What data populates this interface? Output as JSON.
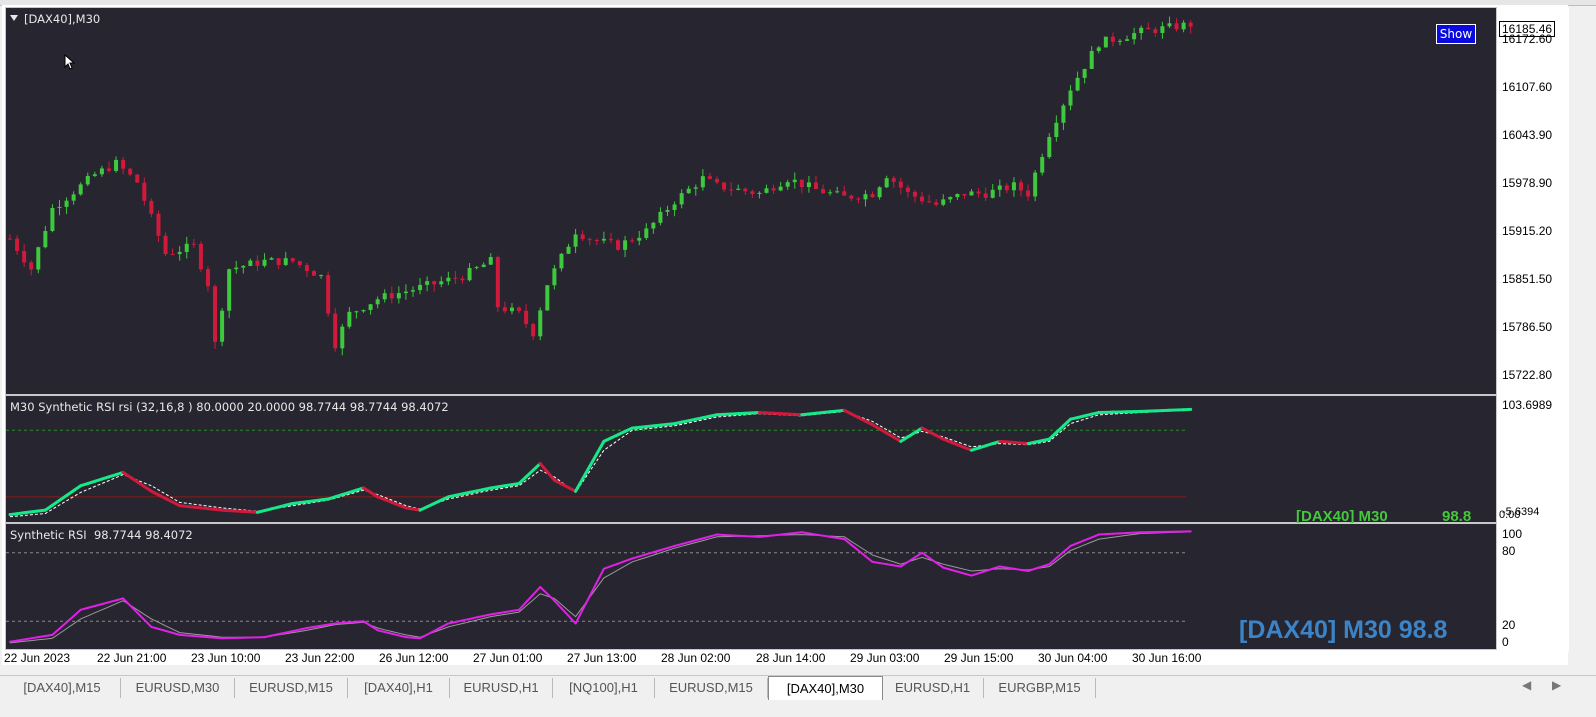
{
  "main_chart": {
    "title": "[DAX40],M30",
    "show_button": "Show",
    "y_labels": [
      "16172.60",
      "16107.60",
      "16043.90",
      "15978.90",
      "15915.20",
      "15851.50",
      "15786.50",
      "15722.80"
    ],
    "current_price": "16185.46"
  },
  "rsi1": {
    "title": "M30 Synthetic RSI rsi (32,16,8 ) 80.0000 20.0000 98.7744 98.7744 98.4072",
    "y_top": "103.6989",
    "y_bottom": "0.00",
    "y_bottom_overlap": "-5.6394",
    "label_symbol": "[DAX40] M30",
    "label_value": "98.8"
  },
  "rsi2": {
    "title": "Synthetic RSI  98.7744 98.4072",
    "y_labels": [
      "100",
      "80",
      "20",
      "0"
    ],
    "label": "[DAX40] M30 98.8"
  },
  "x_labels": [
    "22 Jun 2023",
    "22 Jun 21:00",
    "23 Jun 10:00",
    "23 Jun 22:00",
    "26 Jun 12:00",
    "27 Jun 01:00",
    "27 Jun 13:00",
    "28 Jun 02:00",
    "28 Jun 14:00",
    "29 Jun 03:00",
    "29 Jun 15:00",
    "30 Jun 04:00",
    "30 Jun 16:00"
  ],
  "tabs": [
    "[DAX40],M15",
    "EURUSD,M30",
    "EURUSD,M15",
    "[DAX40],H1",
    "EURUSD,H1",
    "[NQ100],H1",
    "EURUSD,M15",
    "[DAX40],M30",
    "EURUSD,H1",
    "EURGBP,M15"
  ],
  "active_tab": "[DAX40],M30",
  "colors": {
    "background": "#272530",
    "bull_candle": "#3ec83e",
    "bear_candle": "#d01a3c",
    "rsi_up": "#17e889",
    "rsi_down": "#d01a3c",
    "rsi_signal": "#ffffff",
    "rsi2_line": "#e020e8",
    "rsi2_signal": "#9a9a9a",
    "level_upper": "#2a8a2a",
    "level_lower": "#8a1a1a",
    "label_blue": "#3c84c8",
    "label_green": "#44c93a"
  },
  "chart_data": [
    {
      "type": "candlestick",
      "title": "[DAX40],M30",
      "ylim": [
        15700,
        16200
      ],
      "x_ticks": [
        "22 Jun 2023",
        "22 Jun 21:00",
        "23 Jun 10:00",
        "23 Jun 22:00",
        "26 Jun 12:00",
        "27 Jun 01:00",
        "27 Jun 13:00",
        "28 Jun 02:00",
        "28 Jun 14:00",
        "29 Jun 03:00",
        "29 Jun 15:00",
        "30 Jun 04:00",
        "30 Jun 16:00"
      ],
      "close_path": [
        [
          0,
          15900
        ],
        [
          3,
          15860
        ],
        [
          6,
          15940
        ],
        [
          12,
          15985
        ],
        [
          15,
          16000
        ],
        [
          18,
          15975
        ],
        [
          22,
          15880
        ],
        [
          26,
          15890
        ],
        [
          28,
          15840
        ],
        [
          29,
          15760
        ],
        [
          31,
          15860
        ],
        [
          36,
          15870
        ],
        [
          40,
          15870
        ],
        [
          44,
          15850
        ],
        [
          46,
          15760
        ],
        [
          48,
          15800
        ],
        [
          52,
          15820
        ],
        [
          56,
          15830
        ],
        [
          60,
          15840
        ],
        [
          64,
          15850
        ],
        [
          68,
          15870
        ],
        [
          69,
          15810
        ],
        [
          72,
          15800
        ],
        [
          74,
          15775
        ],
        [
          76,
          15840
        ],
        [
          80,
          15910
        ],
        [
          82,
          15900
        ],
        [
          86,
          15890
        ],
        [
          90,
          15910
        ],
        [
          94,
          15950
        ],
        [
          98,
          15980
        ],
        [
          100,
          15970
        ],
        [
          106,
          15960
        ],
        [
          110,
          15980
        ],
        [
          114,
          15965
        ],
        [
          118,
          15955
        ],
        [
          122,
          15960
        ],
        [
          124,
          15985
        ],
        [
          127,
          15960
        ],
        [
          131,
          15945
        ],
        [
          135,
          15960
        ],
        [
          138,
          15960
        ],
        [
          142,
          15970
        ],
        [
          144,
          15960
        ],
        [
          147,
          16040
        ],
        [
          150,
          16100
        ],
        [
          154,
          16160
        ],
        [
          160,
          16175
        ],
        [
          167,
          16185
        ]
      ]
    },
    {
      "type": "line",
      "title": "M30 Synthetic RSI rsi (32,16,8 )",
      "ylim": [
        0,
        103.6989
      ],
      "levels": [
        80,
        20
      ],
      "series": [
        {
          "name": "rsi",
          "values": [
            [
              0,
              4
            ],
            [
              5,
              8
            ],
            [
              10,
              30
            ],
            [
              16,
              42
            ],
            [
              20,
              25
            ],
            [
              24,
              12
            ],
            [
              30,
              8
            ],
            [
              35,
              6
            ],
            [
              40,
              14
            ],
            [
              45,
              18
            ],
            [
              50,
              28
            ],
            [
              52,
              20
            ],
            [
              56,
              10
            ],
            [
              58,
              8
            ],
            [
              62,
              20
            ],
            [
              68,
              28
            ],
            [
              72,
              32
            ],
            [
              75,
              50
            ],
            [
              77,
              35
            ],
            [
              80,
              25
            ],
            [
              84,
              70
            ],
            [
              88,
              82
            ],
            [
              94,
              86
            ],
            [
              100,
              94
            ],
            [
              106,
              96
            ],
            [
              112,
              94
            ],
            [
              118,
              98
            ],
            [
              122,
              85
            ],
            [
              126,
              70
            ],
            [
              129,
              82
            ],
            [
              132,
              72
            ],
            [
              136,
              62
            ],
            [
              140,
              70
            ],
            [
              144,
              68
            ],
            [
              147,
              72
            ],
            [
              150,
              90
            ],
            [
              154,
              96
            ],
            [
              160,
              97
            ],
            [
              167,
              98.8
            ]
          ]
        },
        {
          "name": "signal",
          "values": [
            [
              0,
              2
            ],
            [
              5,
              5
            ],
            [
              10,
              24
            ],
            [
              16,
              40
            ],
            [
              20,
              30
            ],
            [
              24,
              15
            ],
            [
              30,
              10
            ],
            [
              35,
              7
            ],
            [
              40,
              12
            ],
            [
              45,
              17
            ],
            [
              50,
              26
            ],
            [
              52,
              22
            ],
            [
              56,
              12
            ],
            [
              58,
              9
            ],
            [
              62,
              18
            ],
            [
              68,
              26
            ],
            [
              72,
              30
            ],
            [
              75,
              44
            ],
            [
              77,
              38
            ],
            [
              80,
              24
            ],
            [
              84,
              62
            ],
            [
              88,
              80
            ],
            [
              94,
              84
            ],
            [
              100,
              92
            ],
            [
              106,
              95
            ],
            [
              112,
              93
            ],
            [
              118,
              97
            ],
            [
              122,
              88
            ],
            [
              126,
              73
            ],
            [
              129,
              79
            ],
            [
              132,
              74
            ],
            [
              136,
              65
            ],
            [
              140,
              68
            ],
            [
              144,
              67
            ],
            [
              147,
              70
            ],
            [
              150,
              86
            ],
            [
              154,
              94
            ],
            [
              160,
              96
            ],
            [
              167,
              98.4
            ]
          ]
        }
      ]
    },
    {
      "type": "line",
      "title": "Synthetic RSI",
      "ylim": [
        0,
        100
      ],
      "levels": [
        80,
        20
      ],
      "series": [
        {
          "name": "rsi",
          "values": [
            [
              0,
              2
            ],
            [
              6,
              8
            ],
            [
              10,
              30
            ],
            [
              16,
              40
            ],
            [
              20,
              15
            ],
            [
              24,
              8
            ],
            [
              30,
              5
            ],
            [
              36,
              6
            ],
            [
              42,
              14
            ],
            [
              46,
              18
            ],
            [
              50,
              20
            ],
            [
              52,
              12
            ],
            [
              56,
              6
            ],
            [
              58,
              5
            ],
            [
              62,
              18
            ],
            [
              68,
              26
            ],
            [
              72,
              30
            ],
            [
              75,
              50
            ],
            [
              77,
              38
            ],
            [
              80,
              18
            ],
            [
              84,
              66
            ],
            [
              88,
              75
            ],
            [
              94,
              86
            ],
            [
              100,
              96
            ],
            [
              106,
              94
            ],
            [
              112,
              98
            ],
            [
              118,
              92
            ],
            [
              122,
              72
            ],
            [
              126,
              68
            ],
            [
              129,
              80
            ],
            [
              132,
              67
            ],
            [
              136,
              60
            ],
            [
              140,
              68
            ],
            [
              144,
              64
            ],
            [
              147,
              70
            ],
            [
              150,
              86
            ],
            [
              154,
              96
            ],
            [
              160,
              98
            ],
            [
              167,
              98.8
            ]
          ]
        },
        {
          "name": "signal",
          "values": [
            [
              0,
              1
            ],
            [
              6,
              5
            ],
            [
              10,
              22
            ],
            [
              16,
              38
            ],
            [
              20,
              22
            ],
            [
              24,
              10
            ],
            [
              30,
              6
            ],
            [
              36,
              6
            ],
            [
              42,
              12
            ],
            [
              46,
              17
            ],
            [
              50,
              19
            ],
            [
              52,
              14
            ],
            [
              56,
              8
            ],
            [
              58,
              6
            ],
            [
              62,
              15
            ],
            [
              68,
              24
            ],
            [
              72,
              28
            ],
            [
              75,
              44
            ],
            [
              77,
              40
            ],
            [
              80,
              24
            ],
            [
              84,
              58
            ],
            [
              88,
              72
            ],
            [
              94,
              84
            ],
            [
              100,
              94
            ],
            [
              106,
              95
            ],
            [
              112,
              96
            ],
            [
              118,
              94
            ],
            [
              122,
              78
            ],
            [
              126,
              70
            ],
            [
              129,
              76
            ],
            [
              132,
              70
            ],
            [
              136,
              64
            ],
            [
              140,
              66
            ],
            [
              144,
              65
            ],
            [
              147,
              68
            ],
            [
              150,
              82
            ],
            [
              154,
              92
            ],
            [
              160,
              97
            ],
            [
              167,
              98.4
            ]
          ]
        }
      ]
    }
  ]
}
